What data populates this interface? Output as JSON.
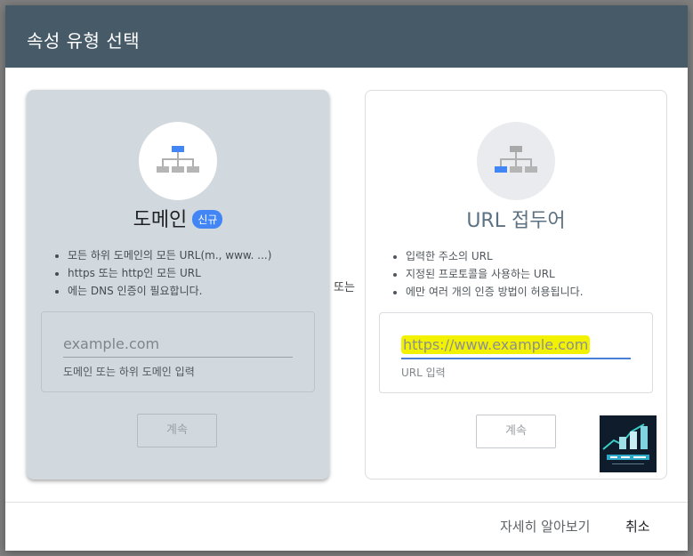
{
  "dialog": {
    "title": "속성 유형 선택"
  },
  "domain_card": {
    "title": "도메인",
    "badge": "신규",
    "icon": "sitemap-icon",
    "features": [
      "모든 하위 도메인의 모든 URL(m., www. ...)",
      "https 또는 http인 모든 URL",
      "에는 DNS 인증이 필요합니다."
    ],
    "input_placeholder": "example.com",
    "input_hint": "도메인 또는 하위 도메인 입력",
    "continue_label": "계속"
  },
  "separator": "또는",
  "url_card": {
    "title": "URL 접두어",
    "icon": "sitemap-icon",
    "features": [
      "입력한 주소의 URL",
      "지정된 프로토콜을 사용하는 URL",
      "에만 여러 개의 인증 방법이 허용됩니다."
    ],
    "input_placeholder": "https://www.example.com",
    "input_hint": "URL 입력",
    "continue_label": "계속"
  },
  "footer": {
    "learn_more": "자세히 알아보기",
    "cancel": "취소"
  },
  "colors": {
    "header_bg": "#475a68",
    "domain_card_bg": "#d2d9de",
    "accent": "#4285f4",
    "highlight": "#f2f200"
  }
}
